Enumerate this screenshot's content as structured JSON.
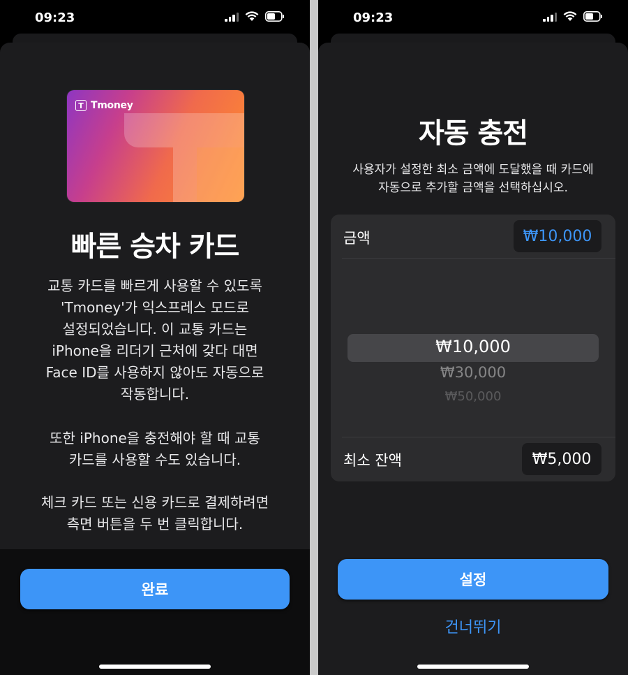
{
  "colors": {
    "accent": "#3d95f7",
    "sheet": "#1c1c1e",
    "group": "#2c2c2e"
  },
  "left": {
    "status": {
      "time": "09:23",
      "icons": [
        "signal-icon",
        "wifi-icon",
        "battery-icon"
      ]
    },
    "card": {
      "brand": "Tmoney",
      "logo_glyph": "T"
    },
    "title": "빠른 승차 카드",
    "paragraph1": "교통 카드를 빠르게 사용할 수 있도록\n'Tmoney'가 익스프레스 모드로\n설정되었습니다. 이 교통 카드는\niPhone을 리더기 근처에 갖다 대면\nFace ID를 사용하지 않아도 자동으로\n작동합니다.",
    "paragraph2": "또한 iPhone을 충전해야 할 때 교통\n카드를 사용할 수도 있습니다.",
    "paragraph3": "체크 카드 또는 신용 카드로 결제하려면\n측면 버튼을 두 번 클릭합니다.",
    "done_label": "완료"
  },
  "right": {
    "status": {
      "time": "09:23",
      "icons": [
        "signal-icon",
        "wifi-icon",
        "battery-icon"
      ]
    },
    "title": "자동 충전",
    "description": "사용자가 설정한 최소 금액에 도달했을 때 카드에\n자동으로 추가할 금액을 선택하십시오.",
    "amount": {
      "label": "금액",
      "value": "₩10,000"
    },
    "picker": {
      "options": [
        "₩10,000",
        "₩30,000",
        "₩50,000"
      ],
      "selected": "₩10,000"
    },
    "min_balance": {
      "label": "최소 잔액",
      "value": "₩5,000"
    },
    "set_label": "설정",
    "skip_label": "건너뛰기"
  }
}
